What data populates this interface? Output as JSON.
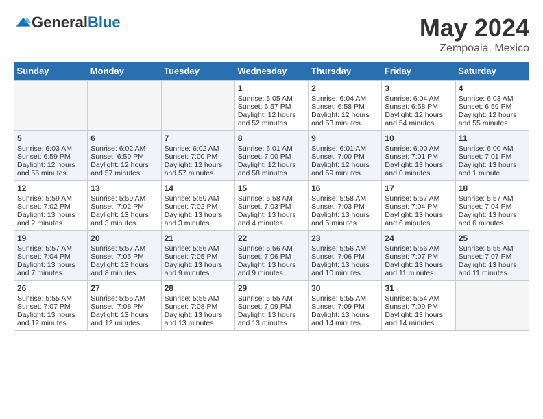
{
  "header": {
    "logo_general": "General",
    "logo_blue": "Blue",
    "month_title": "May 2024",
    "location": "Zempoala, Mexico"
  },
  "days_of_week": [
    "Sunday",
    "Monday",
    "Tuesday",
    "Wednesday",
    "Thursday",
    "Friday",
    "Saturday"
  ],
  "weeks": [
    [
      {
        "day": "",
        "empty": true
      },
      {
        "day": "",
        "empty": true
      },
      {
        "day": "",
        "empty": true
      },
      {
        "day": "1",
        "sunrise": "Sunrise: 6:05 AM",
        "sunset": "Sunset: 6:57 PM",
        "daylight": "Daylight: 12 hours and 52 minutes."
      },
      {
        "day": "2",
        "sunrise": "Sunrise: 6:04 AM",
        "sunset": "Sunset: 6:58 PM",
        "daylight": "Daylight: 12 hours and 53 minutes."
      },
      {
        "day": "3",
        "sunrise": "Sunrise: 6:04 AM",
        "sunset": "Sunset: 6:58 PM",
        "daylight": "Daylight: 12 hours and 54 minutes."
      },
      {
        "day": "4",
        "sunrise": "Sunrise: 6:03 AM",
        "sunset": "Sunset: 6:59 PM",
        "daylight": "Daylight: 12 hours and 55 minutes."
      }
    ],
    [
      {
        "day": "5",
        "sunrise": "Sunrise: 6:03 AM",
        "sunset": "Sunset: 6:59 PM",
        "daylight": "Daylight: 12 hours and 56 minutes."
      },
      {
        "day": "6",
        "sunrise": "Sunrise: 6:02 AM",
        "sunset": "Sunset: 6:59 PM",
        "daylight": "Daylight: 12 hours and 57 minutes."
      },
      {
        "day": "7",
        "sunrise": "Sunrise: 6:02 AM",
        "sunset": "Sunset: 7:00 PM",
        "daylight": "Daylight: 12 hours and 57 minutes."
      },
      {
        "day": "8",
        "sunrise": "Sunrise: 6:01 AM",
        "sunset": "Sunset: 7:00 PM",
        "daylight": "Daylight: 12 hours and 58 minutes."
      },
      {
        "day": "9",
        "sunrise": "Sunrise: 6:01 AM",
        "sunset": "Sunset: 7:00 PM",
        "daylight": "Daylight: 12 hours and 59 minutes."
      },
      {
        "day": "10",
        "sunrise": "Sunrise: 6:00 AM",
        "sunset": "Sunset: 7:01 PM",
        "daylight": "Daylight: 13 hours and 0 minutes."
      },
      {
        "day": "11",
        "sunrise": "Sunrise: 6:00 AM",
        "sunset": "Sunset: 7:01 PM",
        "daylight": "Daylight: 13 hours and 1 minute."
      }
    ],
    [
      {
        "day": "12",
        "sunrise": "Sunrise: 5:59 AM",
        "sunset": "Sunset: 7:02 PM",
        "daylight": "Daylight: 13 hours and 2 minutes."
      },
      {
        "day": "13",
        "sunrise": "Sunrise: 5:59 AM",
        "sunset": "Sunset: 7:02 PM",
        "daylight": "Daylight: 13 hours and 3 minutes."
      },
      {
        "day": "14",
        "sunrise": "Sunrise: 5:59 AM",
        "sunset": "Sunset: 7:02 PM",
        "daylight": "Daylight: 13 hours and 3 minutes."
      },
      {
        "day": "15",
        "sunrise": "Sunrise: 5:58 AM",
        "sunset": "Sunset: 7:03 PM",
        "daylight": "Daylight: 13 hours and 4 minutes."
      },
      {
        "day": "16",
        "sunrise": "Sunrise: 5:58 AM",
        "sunset": "Sunset: 7:03 PM",
        "daylight": "Daylight: 13 hours and 5 minutes."
      },
      {
        "day": "17",
        "sunrise": "Sunrise: 5:57 AM",
        "sunset": "Sunset: 7:04 PM",
        "daylight": "Daylight: 13 hours and 6 minutes."
      },
      {
        "day": "18",
        "sunrise": "Sunrise: 5:57 AM",
        "sunset": "Sunset: 7:04 PM",
        "daylight": "Daylight: 13 hours and 6 minutes."
      }
    ],
    [
      {
        "day": "19",
        "sunrise": "Sunrise: 5:57 AM",
        "sunset": "Sunset: 7:04 PM",
        "daylight": "Daylight: 13 hours and 7 minutes."
      },
      {
        "day": "20",
        "sunrise": "Sunrise: 5:57 AM",
        "sunset": "Sunset: 7:05 PM",
        "daylight": "Daylight: 13 hours and 8 minutes."
      },
      {
        "day": "21",
        "sunrise": "Sunrise: 5:56 AM",
        "sunset": "Sunset: 7:05 PM",
        "daylight": "Daylight: 13 hours and 9 minutes."
      },
      {
        "day": "22",
        "sunrise": "Sunrise: 5:56 AM",
        "sunset": "Sunset: 7:06 PM",
        "daylight": "Daylight: 13 hours and 9 minutes."
      },
      {
        "day": "23",
        "sunrise": "Sunrise: 5:56 AM",
        "sunset": "Sunset: 7:06 PM",
        "daylight": "Daylight: 13 hours and 10 minutes."
      },
      {
        "day": "24",
        "sunrise": "Sunrise: 5:56 AM",
        "sunset": "Sunset: 7:07 PM",
        "daylight": "Daylight: 13 hours and 11 minutes."
      },
      {
        "day": "25",
        "sunrise": "Sunrise: 5:55 AM",
        "sunset": "Sunset: 7:07 PM",
        "daylight": "Daylight: 13 hours and 11 minutes."
      }
    ],
    [
      {
        "day": "26",
        "sunrise": "Sunrise: 5:55 AM",
        "sunset": "Sunset: 7:07 PM",
        "daylight": "Daylight: 13 hours and 12 minutes."
      },
      {
        "day": "27",
        "sunrise": "Sunrise: 5:55 AM",
        "sunset": "Sunset: 7:08 PM",
        "daylight": "Daylight: 13 hours and 12 minutes."
      },
      {
        "day": "28",
        "sunrise": "Sunrise: 5:55 AM",
        "sunset": "Sunset: 7:08 PM",
        "daylight": "Daylight: 13 hours and 13 minutes."
      },
      {
        "day": "29",
        "sunrise": "Sunrise: 5:55 AM",
        "sunset": "Sunset: 7:09 PM",
        "daylight": "Daylight: 13 hours and 13 minutes."
      },
      {
        "day": "30",
        "sunrise": "Sunrise: 5:55 AM",
        "sunset": "Sunset: 7:09 PM",
        "daylight": "Daylight: 13 hours and 14 minutes."
      },
      {
        "day": "31",
        "sunrise": "Sunrise: 5:54 AM",
        "sunset": "Sunset: 7:09 PM",
        "daylight": "Daylight: 13 hours and 14 minutes."
      },
      {
        "day": "",
        "empty": true
      }
    ]
  ]
}
